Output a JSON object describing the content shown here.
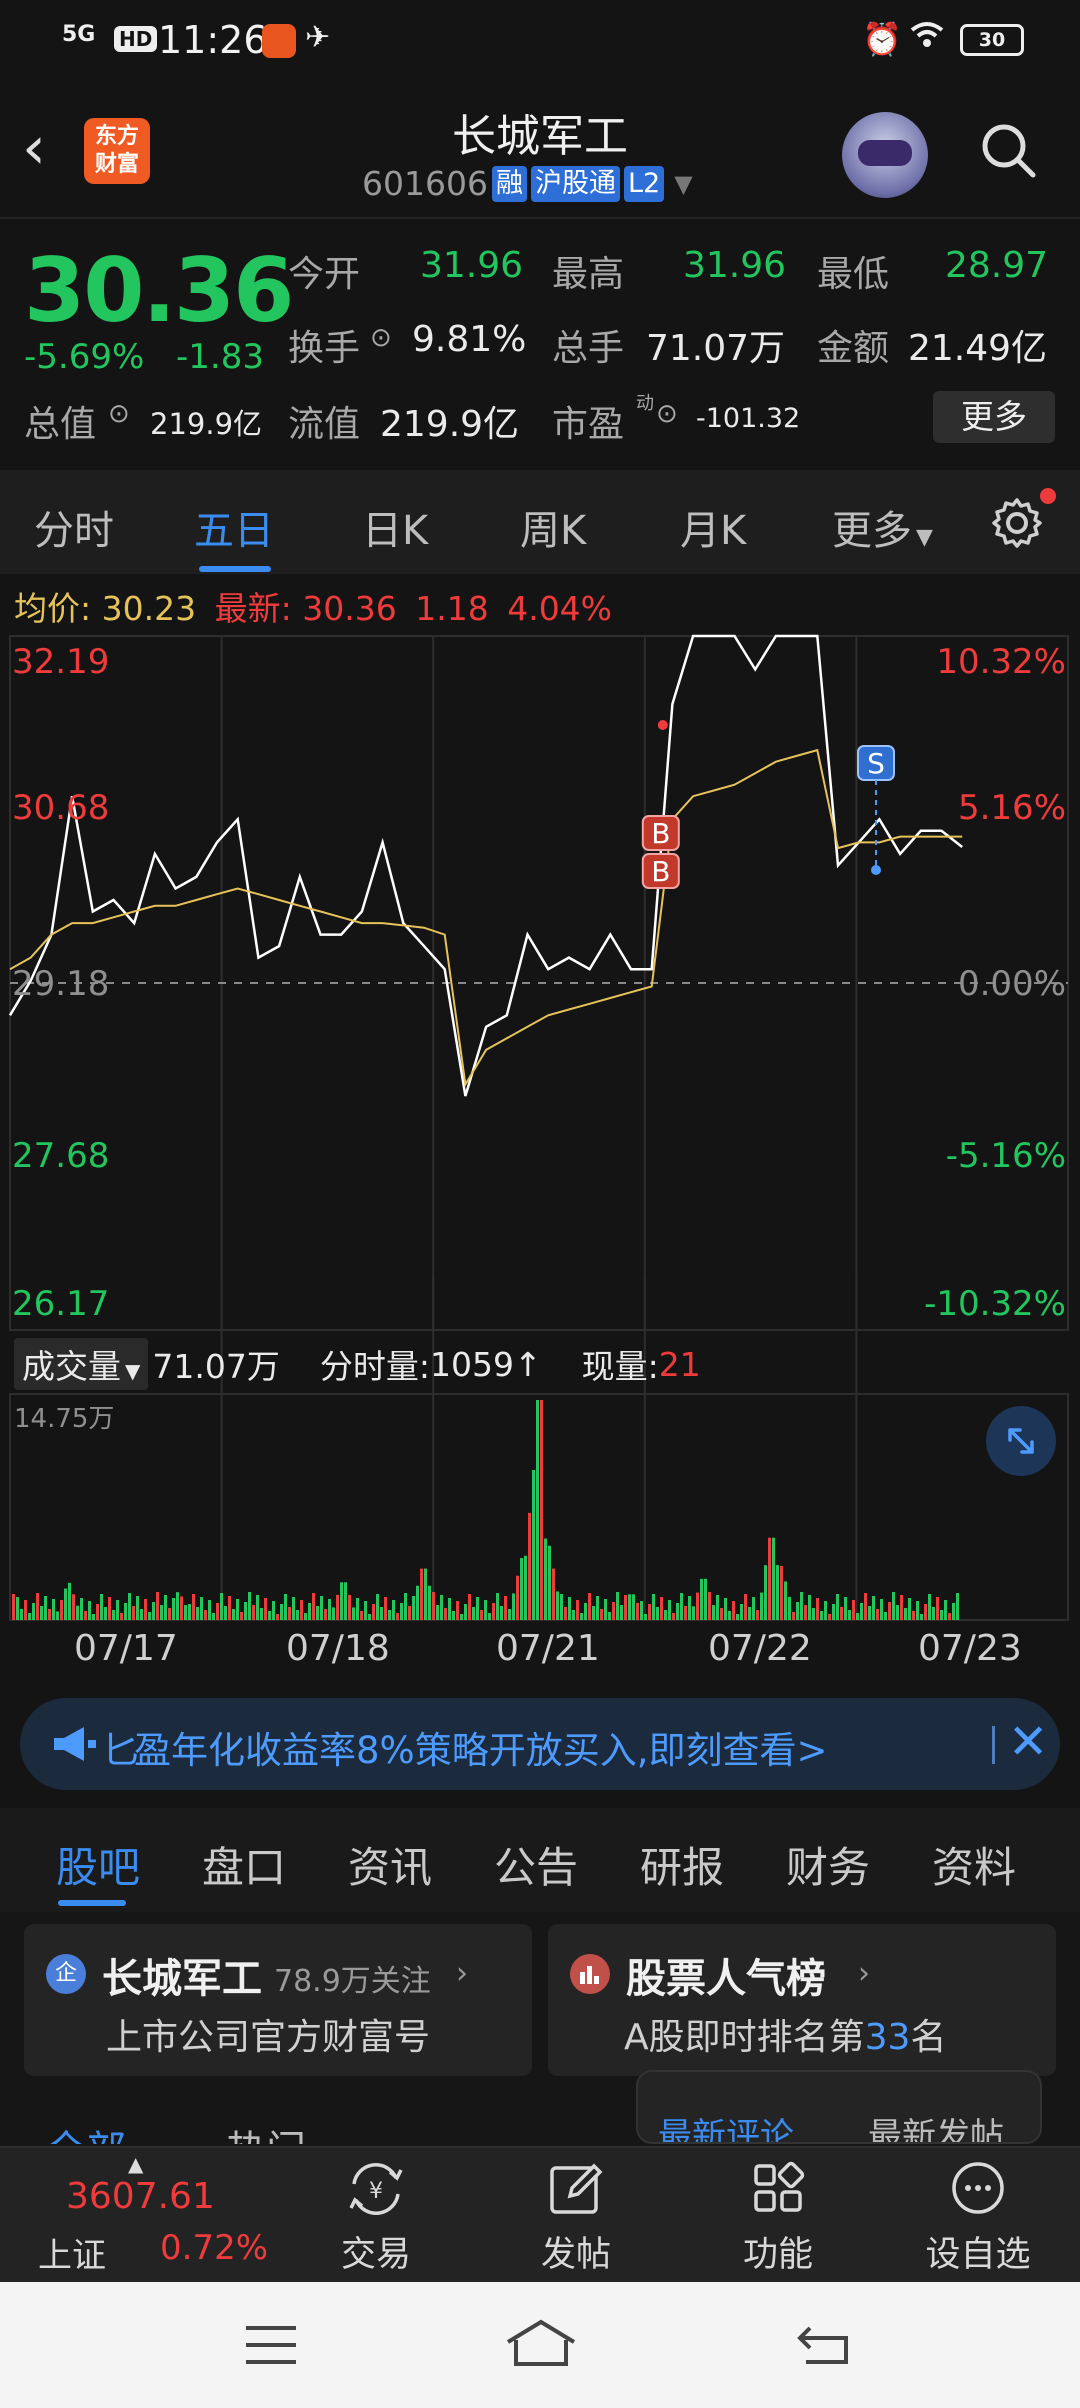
{
  "status_bar": {
    "network": "5G",
    "hd": "HD",
    "time": "11:26",
    "battery": "30"
  },
  "header": {
    "title": "长城军工",
    "code": "601606",
    "tags": [
      "融",
      "沪股通",
      "L2"
    ],
    "logo_text": "东方财富"
  },
  "quote": {
    "price": "30.36",
    "change_pct": "-5.69%",
    "change": "-1.83",
    "open_label": "今开",
    "open": "31.96",
    "high_label": "最高",
    "high": "31.96",
    "low_label": "最低",
    "low": "28.97",
    "turnover_label": "换手",
    "turnover": "9.81%",
    "volume_label": "总手",
    "volume": "71.07万",
    "amount_label": "金额",
    "amount": "21.49亿",
    "mktcap_label": "总值",
    "mktcap": "219.9亿",
    "float_label": "流值",
    "float": "219.9亿",
    "pe_label": "市盈",
    "pe_sup": "动",
    "pe": "-101.32",
    "more_button": "更多"
  },
  "chart_tabs": [
    "分时",
    "五日",
    "日K",
    "周K",
    "月K",
    "更多"
  ],
  "chart_tabs_active": 1,
  "avg_line": {
    "avg_label": "均价:",
    "avg": "30.23",
    "latest_label": "最新:",
    "latest": "30.36",
    "diff": "1.18",
    "pct": "4.04%"
  },
  "chart_data": {
    "type": "line",
    "title": "",
    "x_dates": [
      "07/17",
      "07/18",
      "07/21",
      "07/22",
      "07/23"
    ],
    "y_left_ticks": [
      "32.19",
      "30.68",
      "29.18",
      "27.68",
      "26.17"
    ],
    "y_right_ticks": [
      "10.32%",
      "5.16%",
      "0.00%",
      "-5.16%",
      "-10.32%"
    ],
    "ylim": [
      26.17,
      32.19
    ],
    "base_price": 29.18,
    "series": [
      {
        "role": "price",
        "color": "#ffffff",
        "values": [
          28.9,
          29.2,
          29.6,
          30.8,
          29.8,
          29.9,
          29.7,
          30.3,
          30.0,
          30.1,
          30.4,
          30.6,
          29.4,
          29.5,
          30.1,
          29.6,
          29.6,
          29.8,
          30.4,
          29.7,
          29.5,
          29.3,
          28.2,
          28.8,
          28.9,
          29.6,
          29.3,
          29.4,
          29.3,
          29.6,
          29.3,
          29.3,
          31.6,
          32.19,
          32.19,
          32.19,
          31.9,
          32.19,
          32.19,
          32.19,
          30.2,
          30.4,
          30.6,
          30.3,
          30.5,
          30.5,
          30.36
        ]
      },
      {
        "role": "average",
        "color": "#e6c35a",
        "values": [
          29.3,
          29.4,
          29.6,
          29.7,
          29.7,
          29.75,
          29.8,
          29.85,
          29.85,
          29.9,
          29.95,
          30.0,
          29.95,
          29.9,
          29.85,
          29.8,
          29.75,
          29.7,
          29.7,
          29.68,
          29.66,
          29.6,
          28.3,
          28.6,
          28.7,
          28.8,
          28.9,
          28.95,
          29.0,
          29.05,
          29.1,
          29.15,
          30.6,
          30.8,
          30.85,
          30.9,
          31.0,
          31.1,
          31.15,
          31.2,
          30.35,
          30.4,
          30.4,
          30.45,
          30.45,
          30.45,
          30.45
        ]
      }
    ],
    "markers": [
      {
        "label": "B",
        "type": "buy"
      },
      {
        "label": "B",
        "type": "buy"
      },
      {
        "label": "S",
        "type": "sell"
      }
    ]
  },
  "volume": {
    "selector": "成交量",
    "total": "71.07万",
    "tick_label": "分时量:",
    "tick_value": "1059",
    "now_label": "现量:",
    "now_value": "21",
    "ymax_label": "14.75万"
  },
  "banner": {
    "text": "盈年化收益率8%策略开放买入,即刻查看>",
    "prefix": "匕"
  },
  "bottom_tabs": [
    "股吧",
    "盘口",
    "资讯",
    "公告",
    "研报",
    "财务",
    "资料"
  ],
  "bottom_tabs_active": 0,
  "cards": [
    {
      "name": "长城军工",
      "followers": "78.9万关注",
      "sub": "上市公司官方财富号"
    },
    {
      "name": "股票人气榜",
      "sub_prefix": "A股即时排名第",
      "rank": "33",
      "sub_suffix": "名"
    }
  ],
  "feed_tabs": [
    "全部",
    "热门"
  ],
  "sort_tabs": [
    "最新评论",
    "最新发帖"
  ],
  "bottom_nav": {
    "index_value": "3607.61",
    "index_name": "上证",
    "index_pct": "0.72%",
    "items": [
      "交易",
      "发帖",
      "功能",
      "设自选"
    ]
  }
}
